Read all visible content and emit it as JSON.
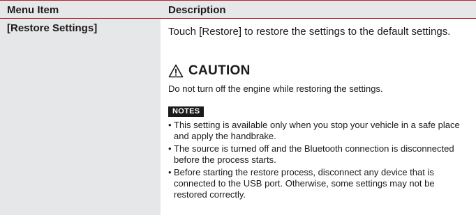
{
  "table": {
    "header": {
      "col1": "Menu Item",
      "col2": "Description"
    },
    "row": {
      "item": "[Restore Settings]",
      "description": "Touch [Restore] to restore the settings to the default settings.",
      "caution": {
        "icon": "warning-triangle-icon",
        "label": "CAUTION",
        "text": "Do not turn off the engine while restoring the settings."
      },
      "notes": {
        "badge": "NOTES",
        "items": [
          "This setting is available only when you stop your vehicle in a safe place and apply the handbrake.",
          "The source is turned off and the Bluetooth connection is disconnected before the process starts.",
          "Before starting the restore process, disconnect any device that is connected to the USB port. Otherwise, some settings may not be restored correctly."
        ]
      }
    }
  },
  "colors": {
    "accent_rule": "#b02a30",
    "cell_shade": "#e6e7e8",
    "badge_bg": "#1a1a1a"
  }
}
